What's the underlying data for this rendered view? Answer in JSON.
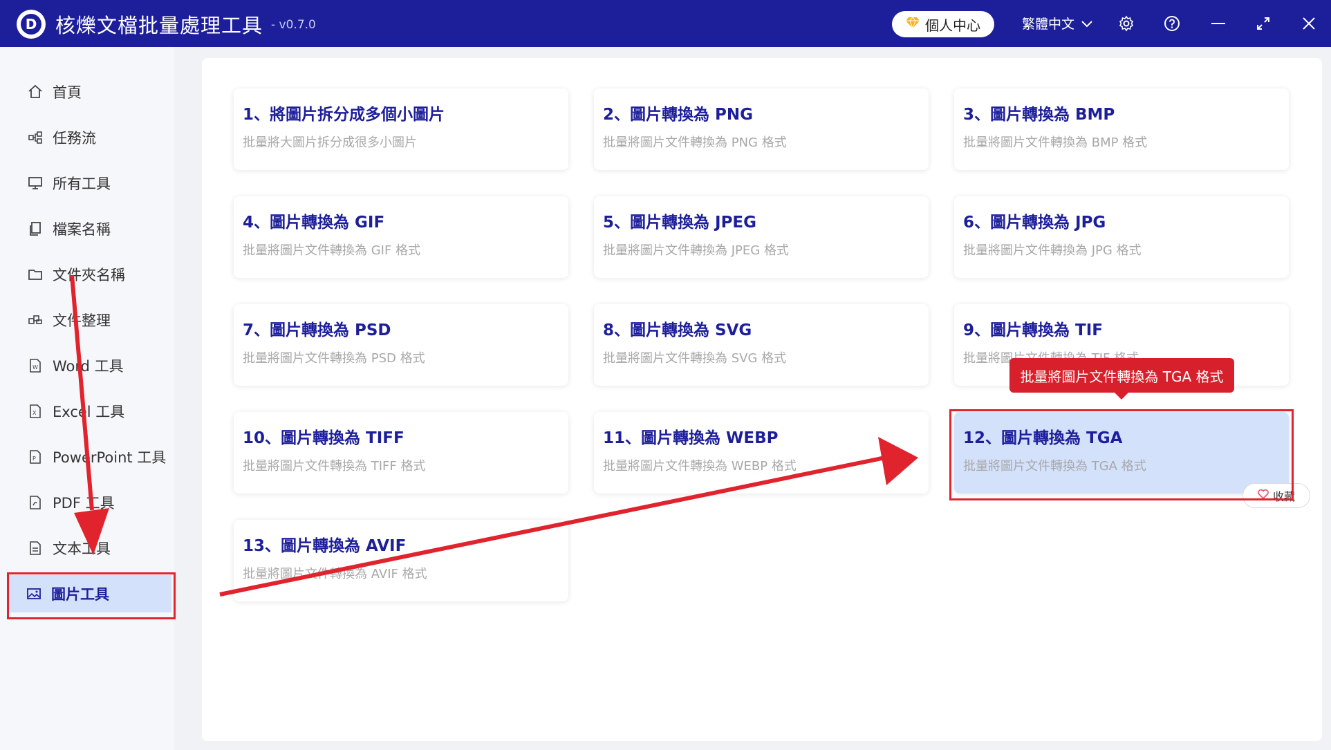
{
  "app": {
    "title": "核爍文檔批量處理工具",
    "version": "- v0.7.0",
    "logo_letter": "D"
  },
  "titlebar": {
    "user_center": "個人中心",
    "language": "繁體中文",
    "icons": [
      "gem-icon",
      "chevron-down-icon",
      "gear-icon",
      "help-icon",
      "minimize-icon",
      "maximize-icon",
      "close-icon"
    ]
  },
  "sidebar": {
    "items": [
      {
        "label": "首頁",
        "icon": "home-icon"
      },
      {
        "label": "任務流",
        "icon": "workflow-icon"
      },
      {
        "label": "所有工具",
        "icon": "monitor-icon"
      },
      {
        "label": "檔案名稱",
        "icon": "file-copy-icon"
      },
      {
        "label": "文件夾名稱",
        "icon": "folder-icon"
      },
      {
        "label": "文件整理",
        "icon": "organize-icon"
      },
      {
        "label": "Word 工具",
        "icon": "word-file-icon"
      },
      {
        "label": "Excel 工具",
        "icon": "excel-file-icon"
      },
      {
        "label": "PowerPoint 工具",
        "icon": "ppt-file-icon"
      },
      {
        "label": "PDF 工具",
        "icon": "pdf-file-icon"
      },
      {
        "label": "文本工具",
        "icon": "text-file-icon"
      },
      {
        "label": "圖片工具",
        "icon": "image-icon",
        "active": true
      }
    ]
  },
  "cards": [
    {
      "title": "1、將圖片拆分成多個小圖片",
      "desc": "批量將大圖片拆分成很多小圖片"
    },
    {
      "title": "2、圖片轉換為 PNG",
      "desc": "批量將圖片文件轉換為 PNG 格式"
    },
    {
      "title": "3、圖片轉換為 BMP",
      "desc": "批量將圖片文件轉換為 BMP 格式"
    },
    {
      "title": "4、圖片轉換為 GIF",
      "desc": "批量將圖片文件轉換為 GIF 格式"
    },
    {
      "title": "5、圖片轉換為 JPEG",
      "desc": "批量將圖片文件轉換為 JPEG 格式"
    },
    {
      "title": "6、圖片轉換為 JPG",
      "desc": "批量將圖片文件轉換為 JPG 格式"
    },
    {
      "title": "7、圖片轉換為 PSD",
      "desc": "批量將圖片文件轉換為 PSD 格式"
    },
    {
      "title": "8、圖片轉換為 SVG",
      "desc": "批量將圖片文件轉換為 SVG 格式"
    },
    {
      "title": "9、圖片轉換為 TIF",
      "desc": "批量將圖片文件轉換為 TIF 格式"
    },
    {
      "title": "10、圖片轉換為 TIFF",
      "desc": "批量將圖片文件轉換為 TIFF 格式"
    },
    {
      "title": "11、圖片轉換為 WEBP",
      "desc": "批量將圖片文件轉換為 WEBP 格式"
    },
    {
      "title": "12、圖片轉換為 TGA",
      "desc": "批量將圖片文件轉換為 TGA 格式",
      "highlighted": true
    },
    {
      "title": "13、圖片轉換為 AVIF",
      "desc": "批量將圖片文件轉換為 AVIF 格式"
    }
  ],
  "tooltip": "批量將圖片文件轉換為 TGA 格式",
  "favorite_label": "收藏",
  "colors": {
    "titlebar": "#1d1f9a",
    "accent_text": "#1d1f9a",
    "active_bg": "#d4e1fb",
    "annotation_red": "#e0232d",
    "tooltip_bg": "#d7202b"
  }
}
